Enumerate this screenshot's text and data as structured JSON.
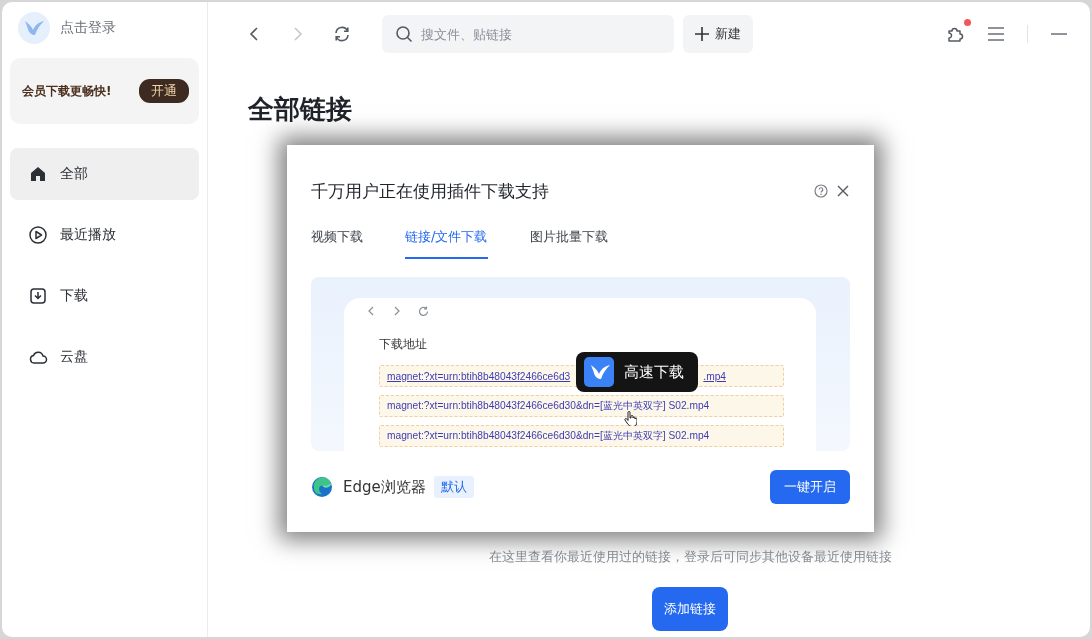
{
  "sidebar": {
    "login": "点击登录",
    "promo": {
      "text": "会员下载更畅快!",
      "button": "开通"
    },
    "items": [
      {
        "label": "全部",
        "selected": true
      },
      {
        "label": "最近播放",
        "selected": false
      },
      {
        "label": "下载",
        "selected": false
      },
      {
        "label": "云盘",
        "selected": false
      }
    ]
  },
  "toolbar": {
    "search": {
      "placeholder": "搜文件、贴链接"
    },
    "new_button": "新建",
    "extension_badge": true
  },
  "page": {
    "title": "全部链接",
    "description": "在这里查看你最近使用过的链接，登录后可同步其他设备最近使用链接",
    "add_button": "添加链接"
  },
  "dialog": {
    "title": "千万用户正在使用插件下载支持",
    "tabs": [
      {
        "label": "视频下载",
        "selected": false
      },
      {
        "label": "链接/文件下载",
        "selected": true
      },
      {
        "label": "图片批量下载",
        "selected": false
      }
    ],
    "preview": {
      "label": "下载地址",
      "tooltip": "高速下载",
      "links": [
        {
          "text": "magnet:?xt=urn:btih8b48043f2466ce6d3",
          "tail": ".mp4",
          "underlined": true
        },
        {
          "text": "magnet:?xt=urn:btih8b48043f2466ce6d30&dn=[蓝光中英双字] S02.mp4",
          "underlined": false
        },
        {
          "text": "magnet:?xt=urn:btih8b48043f2466ce6d30&dn=[蓝光中英双字] S02.mp4",
          "underlined": false
        }
      ]
    },
    "browser": {
      "name": "Edge浏览器",
      "badge": "默认"
    },
    "button": "一键开启"
  }
}
